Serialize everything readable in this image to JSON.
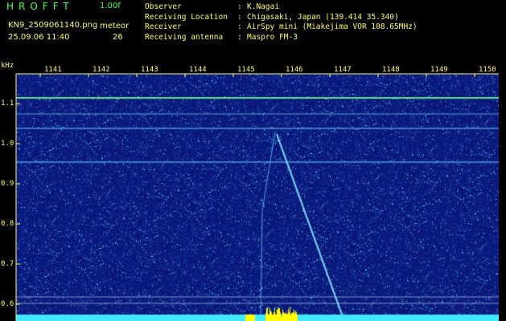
{
  "header": {
    "app_title": "HROFFT",
    "version": "1.00f",
    "file_name": "KN9_2509061140.png",
    "timestamp": "25.09.06 11:40",
    "meteor_label": "meteor",
    "meteor_count": "26"
  },
  "info": [
    {
      "key": "Observer",
      "value": "K.Nagai"
    },
    {
      "key": "Receiving Location",
      "value": "Chigasaki, Japan (139.414 35.340)"
    },
    {
      "key": "Receiver",
      "value": "AirSpy mini (Miakejima VOR 108.65MHz)"
    },
    {
      "key": "Receiving antenna",
      "value": "Maspro FM-3"
    }
  ],
  "axis": {
    "y_unit": "kHz",
    "x_ticks": [
      "1141",
      "1142",
      "1143",
      "1144",
      "1145",
      "1146",
      "1147",
      "1148",
      "1149",
      "1150"
    ],
    "y_ticks": [
      "1.1",
      "1.0",
      "0.9",
      "0.8",
      "0.7",
      "0.6"
    ]
  },
  "colors": {
    "background": "#0a1a78",
    "text": "#ffff66",
    "title": "#4dff4d",
    "trace": "#7fe0ff"
  }
}
